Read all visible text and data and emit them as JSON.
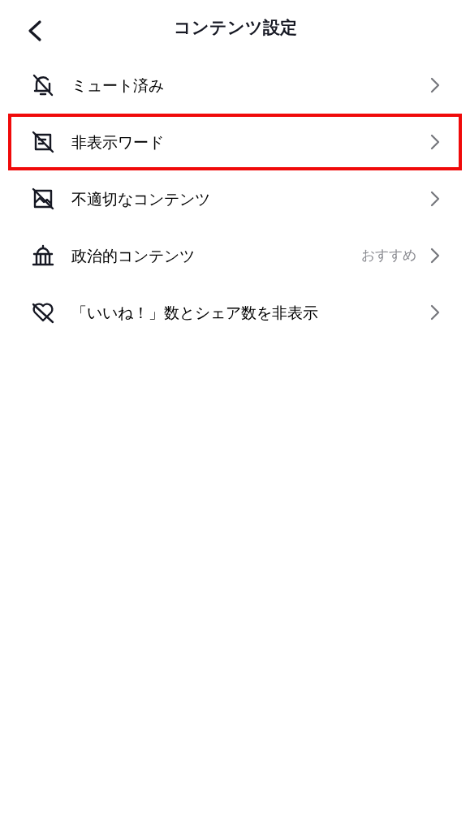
{
  "header": {
    "title": "コンテンツ設定"
  },
  "items": [
    {
      "label": "ミュート済み",
      "highlighted": false
    },
    {
      "label": "非表示ワード",
      "highlighted": true
    },
    {
      "label": "不適切なコンテンツ",
      "highlighted": false
    },
    {
      "label": "政治的コンテンツ",
      "value": "おすすめ",
      "highlighted": false
    },
    {
      "label": "「いいね！」数とシェア数を非表示",
      "highlighted": false
    }
  ]
}
